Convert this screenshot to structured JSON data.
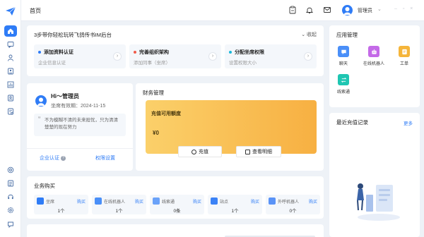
{
  "header": {
    "page_title": "首页",
    "user_name": "管理员"
  },
  "onboarding": {
    "title": "3步带你轻松玩转飞鸽传书IM后台",
    "collapse_label": "收起",
    "steps": [
      {
        "title": "添加资料认证",
        "subtitle": "企业信息认证",
        "color": "#2f7cf6"
      },
      {
        "title": "完善组织架构",
        "subtitle": "添加同事（坐席）",
        "color": "#f05a4a"
      },
      {
        "title": "分配坐席权限",
        "subtitle": "设置权限大小",
        "color": "#19b8d9"
      }
    ]
  },
  "profile": {
    "greeting": "Hi～管理员",
    "expire_label": "坐席有效期：",
    "expire_date": "2024-11-15",
    "quote": "不为模糊不清的未来担忧，只为清清楚楚的现在努力",
    "auth_link": "企业认证",
    "perm_link": "权限设置"
  },
  "finance": {
    "title": "财务管理",
    "quota_label": "充值可用额度",
    "amount": "¥0",
    "recharge_button": "充值",
    "detail_button": "查看明细"
  },
  "purchase": {
    "title": "业务购买",
    "buy_label": "购买",
    "items": [
      {
        "name": "坐席",
        "count": "1个",
        "color": "#2f7cf6"
      },
      {
        "name": "在线机器人",
        "count": "1个",
        "color": "#4a8ff8"
      },
      {
        "name": "线索通",
        "count": "0条",
        "color": "#6aa2f9"
      },
      {
        "name": "站点",
        "count": "1个",
        "color": "#3b82f6"
      },
      {
        "name": "外呼机器人",
        "count": "0个",
        "color": "#5a93f7"
      }
    ]
  },
  "apps": {
    "title": "应用管理",
    "items": [
      {
        "label": "聊天",
        "color": "#4a8ff8"
      },
      {
        "label": "在线机器人",
        "color": "#c46ae8"
      },
      {
        "label": "工单",
        "color": "#f5b53a"
      },
      {
        "label": "线索通",
        "color": "#1fc6b2"
      }
    ]
  },
  "recharge": {
    "title": "最近充值记录",
    "more_label": "更多"
  }
}
